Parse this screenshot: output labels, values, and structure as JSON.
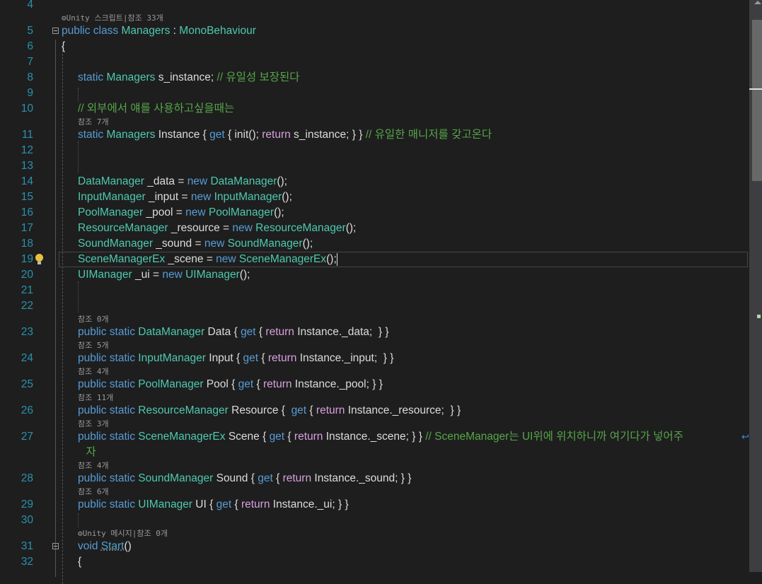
{
  "editor": {
    "rows": [
      {
        "num": "4",
        "tokens": []
      },
      {
        "lens": "⚙Unity 스크립트|참조 33개"
      },
      {
        "num": "5",
        "fold": true,
        "tokens": [
          {
            "c": "kw",
            "t": "public class "
          },
          {
            "c": "type",
            "t": "Managers"
          },
          {
            "c": "plain",
            "t": " : "
          },
          {
            "c": "type",
            "t": "MonoBehaviour"
          }
        ]
      },
      {
        "num": "6",
        "tokens": [
          {
            "c": "plain",
            "t": "{"
          }
        ]
      },
      {
        "num": "7",
        "tokens": []
      },
      {
        "num": "8",
        "indent": 1,
        "tokens": [
          {
            "c": "kw",
            "t": "static "
          },
          {
            "c": "type",
            "t": "Managers"
          },
          {
            "c": "plain",
            "t": " s_instance; "
          },
          {
            "c": "cm",
            "t": "// 유일성 보장된다"
          }
        ]
      },
      {
        "num": "9",
        "tokens": []
      },
      {
        "num": "10",
        "indent": 1,
        "tokens": [
          {
            "c": "cm",
            "t": "// 외부에서 얘를 사용하고싶을때는"
          }
        ]
      },
      {
        "lens": "참조 7개",
        "indent": 1
      },
      {
        "num": "11",
        "indent": 1,
        "tokens": [
          {
            "c": "kw",
            "t": "static "
          },
          {
            "c": "type",
            "t": "Managers"
          },
          {
            "c": "plain",
            "t": " Instance { "
          },
          {
            "c": "kw",
            "t": "get"
          },
          {
            "c": "plain",
            "t": " { init(); "
          },
          {
            "c": "ctl",
            "t": "return"
          },
          {
            "c": "plain",
            "t": " s_instance; } } "
          },
          {
            "c": "cm",
            "t": "// 유일한 매니저를 갖고온다"
          }
        ]
      },
      {
        "num": "12",
        "tokens": []
      },
      {
        "num": "13",
        "tokens": []
      },
      {
        "num": "14",
        "indent": 1,
        "tokens": [
          {
            "c": "type",
            "t": "DataManager"
          },
          {
            "c": "plain",
            "t": " _data = "
          },
          {
            "c": "kw",
            "t": "new "
          },
          {
            "c": "type",
            "t": "DataManager"
          },
          {
            "c": "plain",
            "t": "();"
          }
        ]
      },
      {
        "num": "15",
        "indent": 1,
        "tokens": [
          {
            "c": "type",
            "t": "InputManager"
          },
          {
            "c": "plain",
            "t": " _input = "
          },
          {
            "c": "kw",
            "t": "new "
          },
          {
            "c": "type",
            "t": "InputManager"
          },
          {
            "c": "plain",
            "t": "();"
          }
        ]
      },
      {
        "num": "16",
        "indent": 1,
        "tokens": [
          {
            "c": "type",
            "t": "PoolManager"
          },
          {
            "c": "plain",
            "t": " _pool = "
          },
          {
            "c": "kw",
            "t": "new "
          },
          {
            "c": "type",
            "t": "PoolManager"
          },
          {
            "c": "plain",
            "t": "();"
          }
        ]
      },
      {
        "num": "17",
        "indent": 1,
        "tokens": [
          {
            "c": "type",
            "t": "ResourceManager"
          },
          {
            "c": "plain",
            "t": " _resource = "
          },
          {
            "c": "kw",
            "t": "new "
          },
          {
            "c": "type",
            "t": "ResourceManager"
          },
          {
            "c": "plain",
            "t": "();"
          }
        ]
      },
      {
        "num": "18",
        "indent": 1,
        "tokens": [
          {
            "c": "type",
            "t": "SoundManager"
          },
          {
            "c": "plain",
            "t": " _sound = "
          },
          {
            "c": "kw",
            "t": "new "
          },
          {
            "c": "type",
            "t": "SoundManager"
          },
          {
            "c": "plain",
            "t": "();"
          }
        ]
      },
      {
        "num": "19",
        "indent": 1,
        "current": true,
        "bulb": true,
        "tokens": [
          {
            "c": "type",
            "t": "SceneManagerEx"
          },
          {
            "c": "plain",
            "t": " _scene = "
          },
          {
            "c": "kw",
            "t": "new "
          },
          {
            "c": "type",
            "t": "SceneManagerEx"
          },
          {
            "c": "plain",
            "t": "();"
          }
        ]
      },
      {
        "num": "20",
        "indent": 1,
        "tokens": [
          {
            "c": "type",
            "t": "UIManager"
          },
          {
            "c": "plain",
            "t": " _ui = "
          },
          {
            "c": "kw",
            "t": "new "
          },
          {
            "c": "type",
            "t": "UIManager"
          },
          {
            "c": "plain",
            "t": "();"
          }
        ]
      },
      {
        "num": "21",
        "tokens": []
      },
      {
        "num": "22",
        "tokens": []
      },
      {
        "lens": "참조 0개",
        "indent": 1
      },
      {
        "num": "23",
        "indent": 1,
        "tokens": [
          {
            "c": "kw",
            "t": "public static "
          },
          {
            "c": "type",
            "t": "DataManager"
          },
          {
            "c": "plain",
            "t": " Data { "
          },
          {
            "c": "kw",
            "t": "get"
          },
          {
            "c": "plain",
            "t": " { "
          },
          {
            "c": "ctl",
            "t": "return"
          },
          {
            "c": "plain",
            "t": " Instance._data;  } }"
          }
        ]
      },
      {
        "lens": "참조 5개",
        "indent": 1
      },
      {
        "num": "24",
        "indent": 1,
        "tokens": [
          {
            "c": "kw",
            "t": "public static "
          },
          {
            "c": "type",
            "t": "InputManager"
          },
          {
            "c": "plain",
            "t": " Input { "
          },
          {
            "c": "kw",
            "t": "get"
          },
          {
            "c": "plain",
            "t": " { "
          },
          {
            "c": "ctl",
            "t": "return"
          },
          {
            "c": "plain",
            "t": " Instance._input;  } }"
          }
        ]
      },
      {
        "lens": "참조 4개",
        "indent": 1
      },
      {
        "num": "25",
        "indent": 1,
        "tokens": [
          {
            "c": "kw",
            "t": "public static "
          },
          {
            "c": "type",
            "t": "PoolManager"
          },
          {
            "c": "plain",
            "t": " Pool { "
          },
          {
            "c": "kw",
            "t": "get"
          },
          {
            "c": "plain",
            "t": " { "
          },
          {
            "c": "ctl",
            "t": "return"
          },
          {
            "c": "plain",
            "t": " Instance._pool; } }"
          }
        ]
      },
      {
        "lens": "참조 11개",
        "indent": 1
      },
      {
        "num": "26",
        "indent": 1,
        "tokens": [
          {
            "c": "kw",
            "t": "public static "
          },
          {
            "c": "type",
            "t": "ResourceManager"
          },
          {
            "c": "plain",
            "t": " Resource {  "
          },
          {
            "c": "kw",
            "t": "get"
          },
          {
            "c": "plain",
            "t": " { "
          },
          {
            "c": "ctl",
            "t": "return"
          },
          {
            "c": "plain",
            "t": " Instance._resource;  } }"
          }
        ]
      },
      {
        "lens": "참조 3개",
        "indent": 1
      },
      {
        "num": "27",
        "indent": 1,
        "wrap": true,
        "tokens": [
          {
            "c": "kw",
            "t": "public static "
          },
          {
            "c": "type",
            "t": "SceneManagerEx"
          },
          {
            "c": "plain",
            "t": " Scene { "
          },
          {
            "c": "kw",
            "t": "get"
          },
          {
            "c": "plain",
            "t": " { "
          },
          {
            "c": "ctl",
            "t": "return"
          },
          {
            "c": "plain",
            "t": " Instance._scene; } } "
          },
          {
            "c": "cm",
            "t": "// SceneManager는 UI위에 위치하니까 여기다가 넣어주"
          }
        ]
      },
      {
        "indent": 1.5,
        "tokens": [
          {
            "c": "cm",
            "t": "자"
          }
        ]
      },
      {
        "lens": "참조 4개",
        "indent": 1
      },
      {
        "num": "28",
        "indent": 1,
        "tokens": [
          {
            "c": "kw",
            "t": "public static "
          },
          {
            "c": "type",
            "t": "SoundManager"
          },
          {
            "c": "plain",
            "t": " Sound { "
          },
          {
            "c": "kw",
            "t": "get"
          },
          {
            "c": "plain",
            "t": " { "
          },
          {
            "c": "ctl",
            "t": "return"
          },
          {
            "c": "plain",
            "t": " Instance._sound; } }"
          }
        ]
      },
      {
        "lens": "참조 6개",
        "indent": 1
      },
      {
        "num": "29",
        "indent": 1,
        "tokens": [
          {
            "c": "kw",
            "t": "public static "
          },
          {
            "c": "type",
            "t": "UIManager"
          },
          {
            "c": "plain",
            "t": " UI { "
          },
          {
            "c": "kw",
            "t": "get"
          },
          {
            "c": "plain",
            "t": " { "
          },
          {
            "c": "ctl",
            "t": "return"
          },
          {
            "c": "plain",
            "t": " Instance._ui; } }"
          }
        ]
      },
      {
        "num": "30",
        "tokens": []
      },
      {
        "lens": "⚙Unity 메시지|참조 0개",
        "indent": 1
      },
      {
        "num": "31",
        "indent": 1,
        "fold": true,
        "tokens": [
          {
            "c": "kw",
            "t": "void "
          },
          {
            "c": "meth",
            "t": "Start"
          },
          {
            "c": "plain",
            "t": "()"
          }
        ]
      },
      {
        "num": "32",
        "indent": 1,
        "tokens": [
          {
            "c": "plain",
            "t": "{"
          }
        ]
      }
    ]
  },
  "colors": {
    "background": "#1e1e1e",
    "keyword": "#569cd6",
    "type": "#4ec9b0",
    "comment": "#57a64a",
    "control": "#d8a0df",
    "line_number": "#2b91af"
  },
  "icons": {
    "lightbulb": "lightbulb-icon",
    "fold": "collapse-icon",
    "wrap": "word-wrap-icon"
  }
}
